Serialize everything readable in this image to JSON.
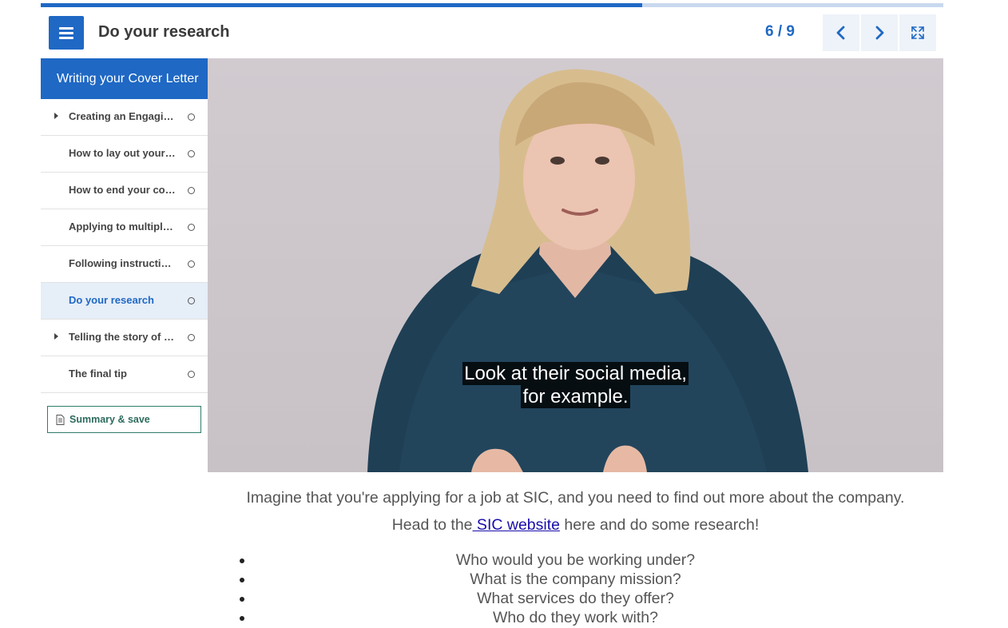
{
  "progress_fraction": 0.667,
  "header": {
    "title": "Do your research",
    "page_count": "6 / 9",
    "menu_icon": "hamburger-icon",
    "prev_icon": "chevron-left-icon",
    "next_icon": "chevron-right-icon",
    "fullscreen_icon": "fullscreen-icon"
  },
  "sidebar": {
    "module_title": "Writing your Cover Letter",
    "items": [
      {
        "label": "Creating an Engaging Opening",
        "has_children": true,
        "active": false
      },
      {
        "label": "How to lay out your cover letter",
        "has_children": false,
        "active": false
      },
      {
        "label": "How to end your cover letter",
        "has_children": false,
        "active": false
      },
      {
        "label": "Applying to multiple jobs",
        "has_children": false,
        "active": false
      },
      {
        "label": "Following instructions",
        "has_children": false,
        "active": false
      },
      {
        "label": "Do your research",
        "has_children": false,
        "active": true
      },
      {
        "label": "Telling the story of you",
        "has_children": true,
        "active": false
      },
      {
        "label": "The final tip",
        "has_children": false,
        "active": false
      }
    ],
    "summary_label": "Summary & save"
  },
  "video": {
    "caption_line1": "Look at their social media,",
    "caption_line2": "for example."
  },
  "content": {
    "intro": "Imagine that you're applying for a job at SIC, and you need to find out more about the company.",
    "head_prefix": "Head to the",
    "link_text": " SIC website",
    "head_suffix": " here and do some research!",
    "bullets": [
      "Who would you be working under?",
      "What is the company mission?",
      "What services do they offer?",
      "Who do they work with?"
    ]
  }
}
